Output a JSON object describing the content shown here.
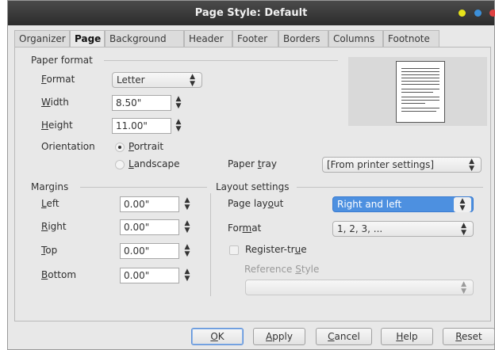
{
  "window": {
    "title": "Page Style: Default",
    "controls": [
      "yellow-dot-icon",
      "blue-dot-icon",
      "red-dot-icon"
    ],
    "control_colors": [
      "#e6e21a",
      "#3c8fd8",
      "#e04242"
    ]
  },
  "tabs": [
    "Organizer",
    "Page",
    "Background",
    "Header",
    "Footer",
    "Borders",
    "Columns",
    "Footnote"
  ],
  "active_tab": "Page",
  "paper_format": {
    "title": "Paper format",
    "format": {
      "label": "Format",
      "value": "Letter"
    },
    "width": {
      "label": "Width",
      "value": "8.50\""
    },
    "height": {
      "label": "Height",
      "value": "11.00\""
    },
    "orientation": {
      "label": "Orientation",
      "portrait": "Portrait",
      "landscape": "Landscape",
      "selected": "Portrait"
    },
    "paper_tray": {
      "label": "Paper tray",
      "value": "[From printer settings]"
    }
  },
  "margins": {
    "title": "Margins",
    "left": {
      "label": "Left",
      "value": "0.00\""
    },
    "right": {
      "label": "Right",
      "value": "0.00\""
    },
    "top": {
      "label": "Top",
      "value": "0.00\""
    },
    "bottom": {
      "label": "Bottom",
      "value": "0.00\""
    }
  },
  "layout": {
    "title": "Layout settings",
    "page_layout": {
      "label": "Page layout",
      "value": "Right and left"
    },
    "format": {
      "label": "Format",
      "value": "1, 2, 3, ..."
    },
    "register_true": {
      "label": "Register-true",
      "checked": false
    },
    "reference_style": {
      "label": "Reference Style",
      "value": ""
    }
  },
  "buttons": {
    "ok": "OK",
    "apply": "Apply",
    "cancel": "Cancel",
    "help": "Help",
    "reset": "Reset"
  },
  "colors": {
    "selection": "#4d90e0",
    "titlebar": "#3a3a3a",
    "background": "#e8e8e8"
  }
}
